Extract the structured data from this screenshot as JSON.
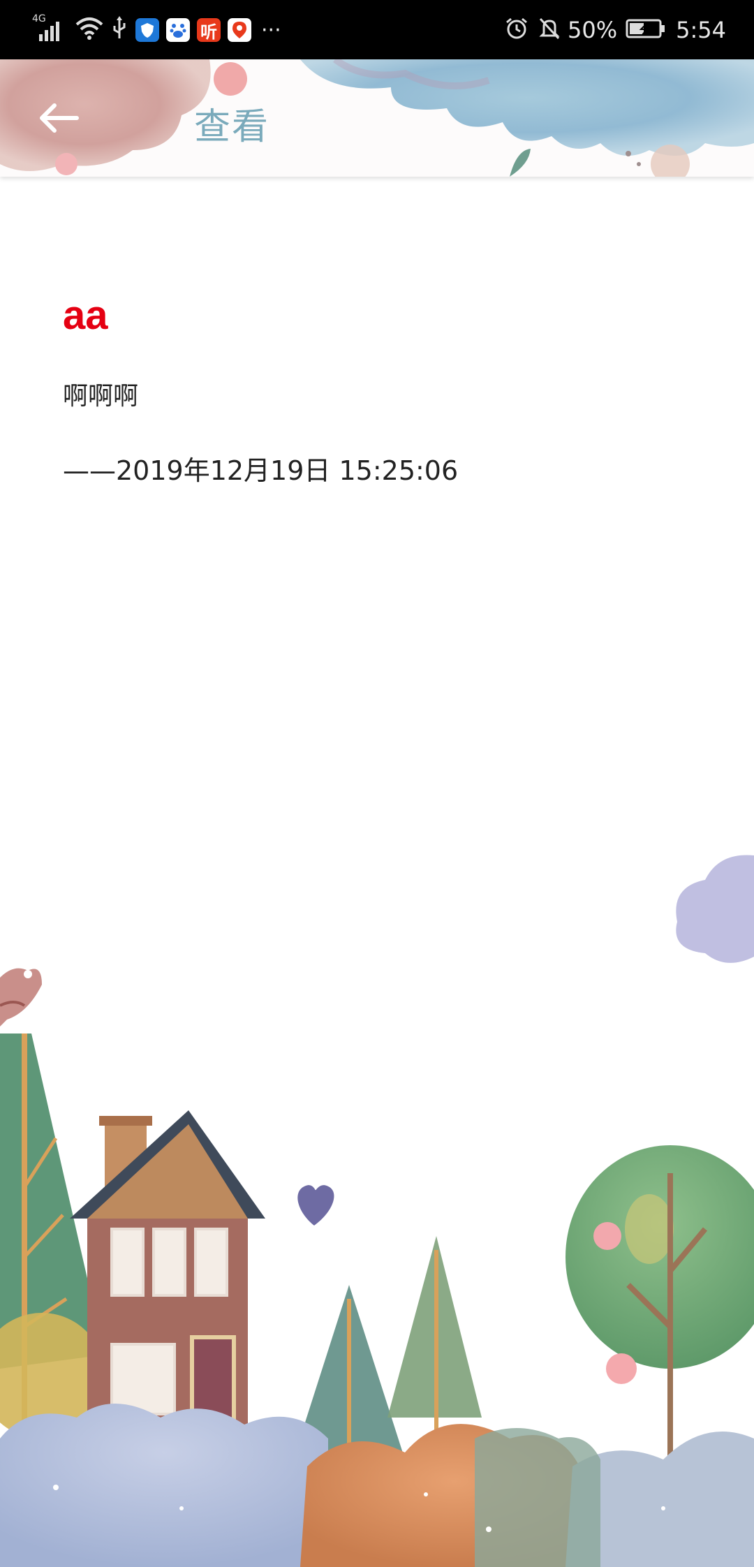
{
  "status_bar": {
    "network": "4G",
    "battery": "50%",
    "time": "5:54",
    "more": "···",
    "icons": [
      "signal-icon",
      "wifi-icon",
      "usb-icon",
      "shield-app-icon",
      "baidu-app-icon",
      "ting-app-icon",
      "map-app-icon",
      "alarm-icon",
      "mute-icon",
      "battery-icon"
    ],
    "app_ting_label": "听"
  },
  "header": {
    "title": "查看",
    "back_icon": "arrow-left-icon",
    "title_color": "#7aaabb"
  },
  "note": {
    "title": "aa",
    "body": "啊啊啊",
    "date": "——2019年12月19日 15:25:06",
    "title_color": "#e50012"
  }
}
